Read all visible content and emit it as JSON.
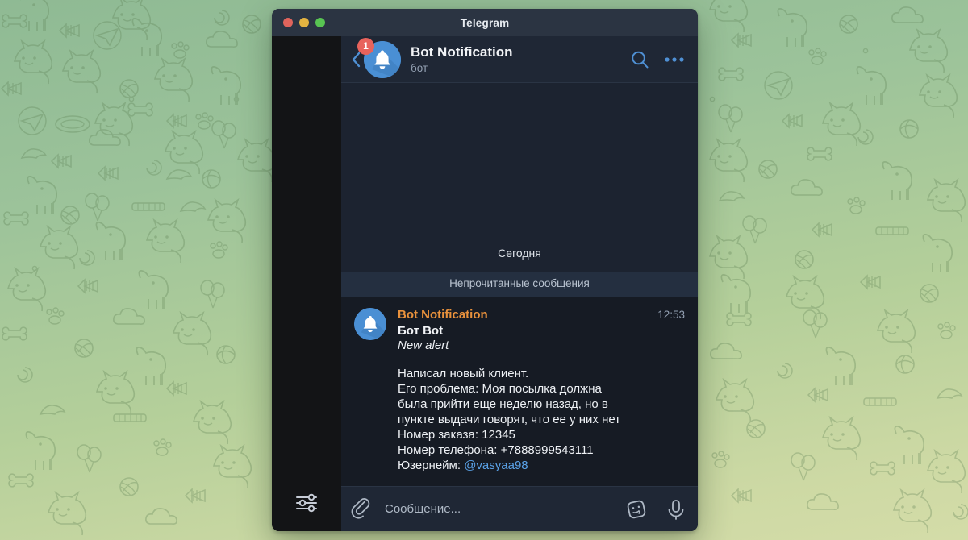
{
  "window": {
    "title": "Telegram",
    "traffic_lights": [
      {
        "name": "close",
        "color": "#e0645c"
      },
      {
        "name": "minimize",
        "color": "#e3b341"
      },
      {
        "name": "maximize",
        "color": "#58c452"
      }
    ]
  },
  "sidebar": {
    "settings_icon": "sliders-icon"
  },
  "chat_header": {
    "back_icon": "back-chevron-icon",
    "unread_badge": "1",
    "avatar_icon": "bell-icon",
    "title": "Bot Notification",
    "subtitle": "бот",
    "search_icon": "search-icon",
    "menu_icon": "more-options-icon"
  },
  "messages": {
    "date_label": "Сегодня",
    "unread_divider": "Непрочитанные сообщения",
    "items": [
      {
        "avatar_icon": "bell-icon",
        "sender": "Bot Notification",
        "time": "12:53",
        "bot_name": "Бот Bot",
        "alert": "New alert",
        "body": "Написал новый клиент.\nЕго проблема: Моя посылка должна была прийти еще неделю назад, но в пункте выдачи говорят, что ее у них нет\nНомер заказа: 12345\nНомер телефона: +7888999543111\nЮзернейм: ",
        "mention": "@vasyaa98"
      }
    ]
  },
  "input_bar": {
    "attach_icon": "paperclip-icon",
    "placeholder": "Сообщение...",
    "emoji_icon": "emoji-smiley-icon",
    "voice_icon": "microphone-icon"
  },
  "colors": {
    "accent_blue": "#5aa2e8",
    "sender_orange": "#e8913c",
    "badge_red": "#e8635c",
    "avatar_blue": "#4a8fd4",
    "chat_bg": "#1c2330",
    "message_bg": "#161b24",
    "header_bg": "#1f2735",
    "sidebar_bg": "#131416",
    "titlebar_bg": "#2b3442"
  }
}
